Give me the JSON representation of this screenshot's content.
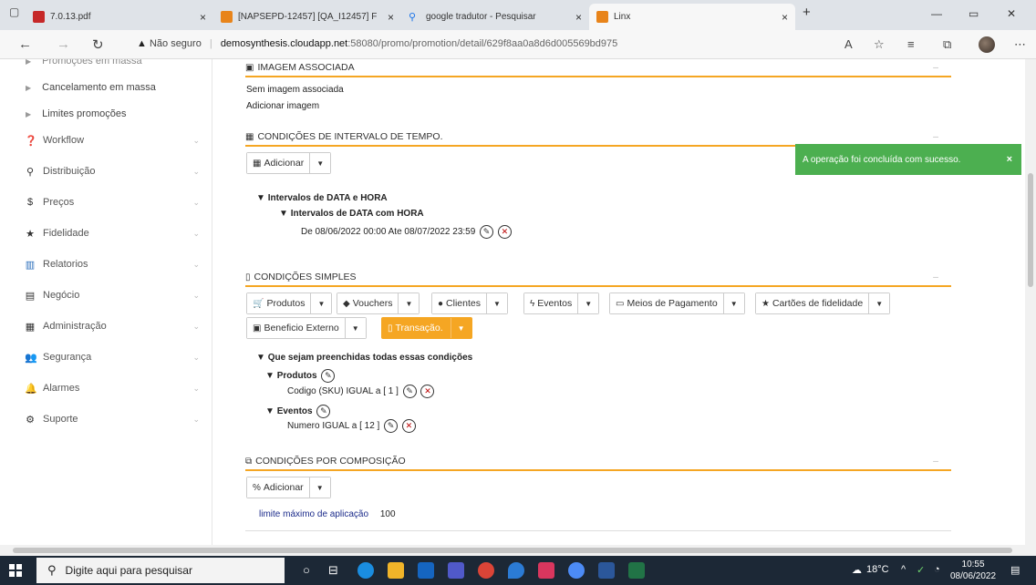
{
  "browser": {
    "tabs": [
      {
        "title": "7.0.13.pdf"
      },
      {
        "title": "[NAPSEPD-12457] [QA_I12457] F"
      },
      {
        "title": "google tradutor - Pesquisar"
      },
      {
        "title": "Linx"
      }
    ],
    "security_label": "Não seguro",
    "url_host": "demosynthesis.cloudapp.net",
    "url_path": ":58080/promo/promotion/detail/629f8aa0a8d6d005569bd975"
  },
  "sidebar": {
    "partial_top": "Promoções em massa",
    "subitems": [
      {
        "label": "Cancelamento em massa"
      },
      {
        "label": "Limites promoções"
      }
    ],
    "items": [
      {
        "label": "Workflow",
        "icon": "help-circle-icon"
      },
      {
        "label": "Distribuição",
        "icon": "map-marker-icon"
      },
      {
        "label": "Preços",
        "icon": "dollar-icon"
      },
      {
        "label": "Fidelidade",
        "icon": "star-icon"
      },
      {
        "label": "Relatorios",
        "icon": "bar-chart-icon"
      },
      {
        "label": "Negócio",
        "icon": "book-icon"
      },
      {
        "label": "Administração",
        "icon": "calendar-icon"
      },
      {
        "label": "Segurança",
        "icon": "users-icon"
      },
      {
        "label": "Alarmes",
        "icon": "bell-icon"
      },
      {
        "label": "Suporte",
        "icon": "cog-icon"
      }
    ]
  },
  "imagem": {
    "header": "IMAGEM ASSOCIADA",
    "no_image": "Sem imagem associada",
    "add_link": "Adicionar imagem"
  },
  "intervalo": {
    "header": "CONDIÇÕES DE INTERVALO DE TEMPO.",
    "add_button": "Adicionar",
    "tree_root": "Intervalos de DATA e HORA",
    "tree_child": "Intervalos de DATA com HORA",
    "range_text": "De 08/06/2022 00:00 Ate 08/07/2022 23:59"
  },
  "simples": {
    "header": "CONDIÇÕES SIMPLES",
    "buttons": [
      {
        "label": "Produtos"
      },
      {
        "label": "Vouchers"
      },
      {
        "label": "Clientes"
      },
      {
        "label": "Eventos"
      },
      {
        "label": "Meios de Pagamento"
      },
      {
        "label": "Cartões de fidelidade"
      },
      {
        "label": "Beneficio Externo"
      },
      {
        "label": "Transação."
      }
    ],
    "root": "Que sejam preenchidas todas essas condições",
    "produtos_label": "Produtos",
    "produtos_cond": "Codigo (SKU) IGUAL a [ 1 ]",
    "eventos_label": "Eventos",
    "eventos_cond": "Numero IGUAL a [ 12 ]"
  },
  "composicao": {
    "header": "CONDIÇÕES POR COMPOSIÇÃO",
    "add_button": "Adicionar",
    "limit_label": "limite máximo de aplicação",
    "limit_value": "100"
  },
  "toast": {
    "message": "A operação foi concluída com sucesso.",
    "close": "×"
  },
  "taskbar": {
    "search_placeholder": "Digite aqui para pesquisar",
    "temperature": "18°C",
    "time": "10:55",
    "date": "08/06/2022"
  },
  "colors": {
    "accent": "#f5a623",
    "success": "#4caf50",
    "taskbar": "#1c2836"
  }
}
